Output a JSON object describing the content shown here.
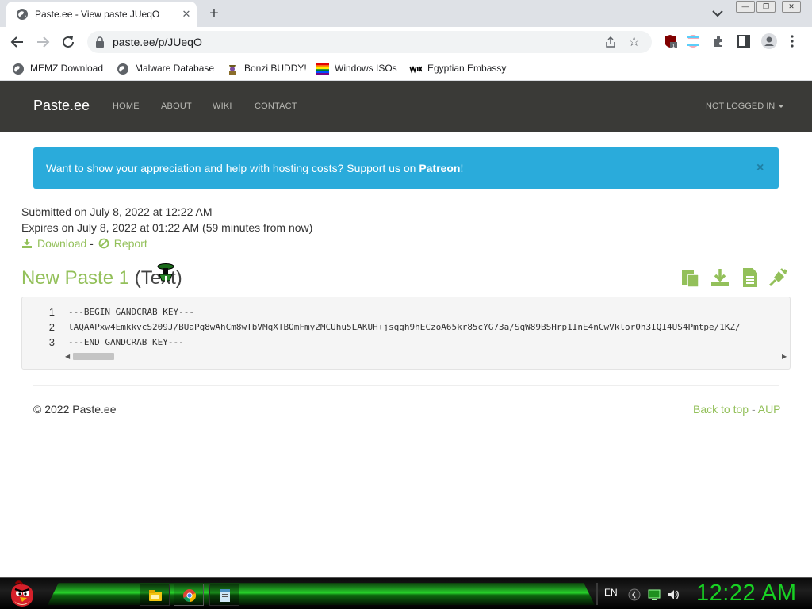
{
  "browser": {
    "tab_title": "Paste.ee - View paste JUeqO",
    "tab_close": "✕",
    "new_tab": "+",
    "url": "paste.ee/p/JUeqO",
    "extension_badge": "1",
    "window_controls": [
      "—",
      "❐",
      "✕"
    ]
  },
  "bookmarks": [
    {
      "label": "MEMZ Download",
      "icon": "globe-icon"
    },
    {
      "label": "Malware Database",
      "icon": "globe-icon"
    },
    {
      "label": "Bonzi BUDDY!",
      "icon": "bonzi-icon"
    },
    {
      "label": "Windows ISOs",
      "icon": "windows-icon"
    },
    {
      "label": "Egyptian Embassy",
      "icon": "wix-icon"
    }
  ],
  "site": {
    "brand": "Paste.ee",
    "nav": [
      "HOME",
      "ABOUT",
      "WIKI",
      "CONTACT"
    ],
    "user_menu": "NOT LOGGED IN"
  },
  "alert": {
    "text": "Want to show your appreciation and help with hosting costs? Support us on ",
    "link": "Patreon",
    "suffix": "!",
    "close": "×"
  },
  "paste": {
    "submitted": "Submitted on July 8, 2022 at 12:22 AM",
    "expires": "Expires on July 8, 2022 at 01:22 AM (59 minutes from now)",
    "download": "Download",
    "separator": "-",
    "report": "Report",
    "title": "New Paste 1",
    "type": "(Text)",
    "lines": [
      {
        "num": "1",
        "text": "---BEGIN GANDCRAB KEY---"
      },
      {
        "num": "2",
        "text": "lAQAAPxw4EmkkvcS209J/BUaPg8wAhCm8wTbVMqXTBOmFmy2MCUhu5LAKUH+jsqgh9hECzoA65kr85cYG73a/SqW89BSHrp1InE4nCwVklor0h3IQI4US4Pmtpe/1KZ/"
      },
      {
        "num": "3",
        "text": "---END GANDCRAB KEY---"
      }
    ]
  },
  "footer": {
    "copyright": "© 2022 Paste.ee",
    "back_to_top": "Back to top",
    "sep": "-",
    "aup": "AUP"
  },
  "taskbar": {
    "language": "EN",
    "clock": "12:22 AM",
    "apps": [
      "file-explorer-icon",
      "chrome-icon",
      "notepad-icon"
    ]
  },
  "colors": {
    "navbar": "#3a3a37",
    "alert": "#2aabdb",
    "accent_green": "#93c05a",
    "clock_green": "#18d123"
  }
}
